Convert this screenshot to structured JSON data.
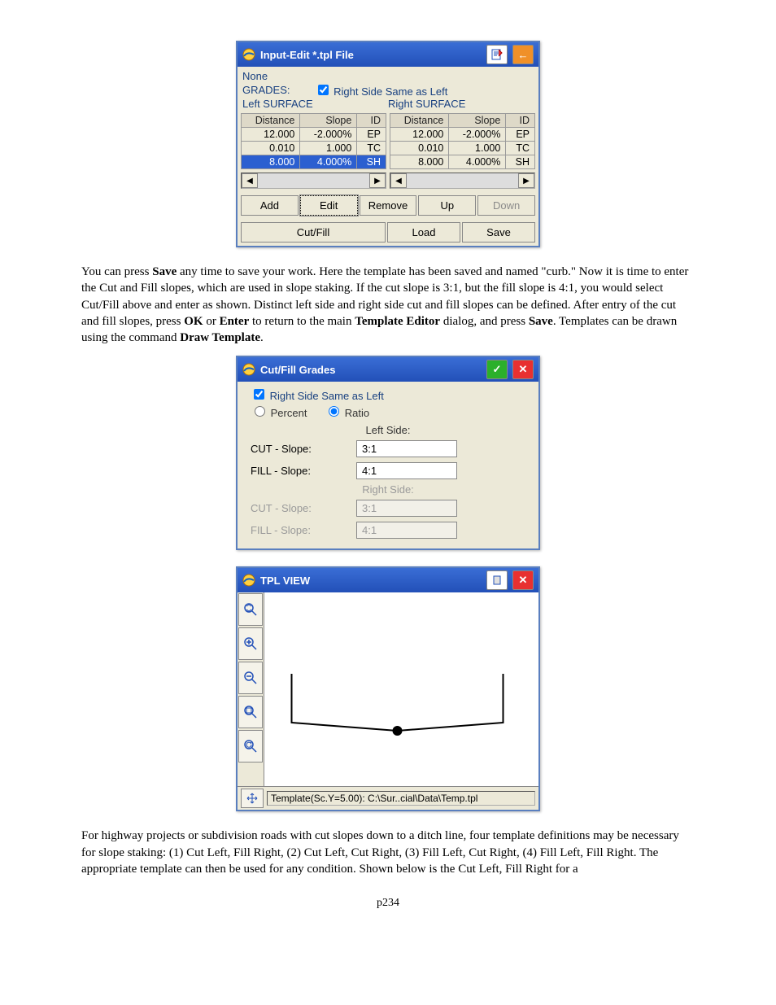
{
  "dialog1": {
    "title": "Input-Edit *.tpl File",
    "none": "None",
    "grades": "GRADES:",
    "chk_label": "Right Side Same as Left",
    "left_surface": "Left SURFACE",
    "right_surface": "Right SURFACE",
    "headers": {
      "distance": "Distance",
      "slope": "Slope",
      "id": "ID"
    },
    "left_rows": [
      {
        "distance": "12.000",
        "slope": "-2.000%",
        "id": "EP"
      },
      {
        "distance": "0.010",
        "slope": "1.000",
        "id": "TC"
      },
      {
        "distance": "8.000",
        "slope": "4.000%",
        "id": "SH",
        "selected": true
      }
    ],
    "right_rows": [
      {
        "distance": "12.000",
        "slope": "-2.000%",
        "id": "EP"
      },
      {
        "distance": "0.010",
        "slope": "1.000",
        "id": "TC"
      },
      {
        "distance": "8.000",
        "slope": "4.000%",
        "id": "SH"
      }
    ],
    "buttons": {
      "add": "Add",
      "edit": "Edit",
      "remove": "Remove",
      "up": "Up",
      "down": "Down",
      "cutfill": "Cut/Fill",
      "load": "Load",
      "save": "Save"
    }
  },
  "para1_a": "You can press ",
  "para1_b": "Save",
  "para1_c": " any time to save your work.  Here the template has been saved and named \"curb.\"  Now it is time to enter the Cut and Fill slopes, which are used in slope staking.  If the cut slope is 3:1, but the fill slope is 4:1, you would select Cut/Fill above and enter as shown.  Distinct left side and right side cut and fill slopes can be defined.  After entry of the cut and fill slopes, press ",
  "para1_d": "OK",
  "para1_e": " or ",
  "para1_f": "Enter",
  "para1_g": " to return to the main  ",
  "para1_h": "Template Editor",
  "para1_i": " dialog, and press ",
  "para1_j": "Save",
  "para1_k": ".  Templates can be drawn using the command ",
  "para1_l": "Draw Template",
  "para1_m": ".",
  "dialog2": {
    "title": "Cut/Fill Grades",
    "chk_label": "Right Side Same as Left",
    "percent": "Percent",
    "ratio": "Ratio",
    "left_side": "Left Side:",
    "right_side": "Right Side:",
    "cut_label": "CUT - Slope:",
    "fill_label": "FILL - Slope:",
    "left_cut": "3:1",
    "left_fill": "4:1",
    "right_cut": "3:1",
    "right_fill": "4:1"
  },
  "dialog3": {
    "title": "TPL VIEW",
    "status": "Template(Sc.Y=5.00): C:\\Sur..cial\\Data\\Temp.tpl"
  },
  "para2": "For highway projects or subdivision roads with cut slopes down to a ditch line, four template definitions may be necessary for slope staking:  (1) Cut Left, Fill Right, (2) Cut Left, Cut Right, (3) Fill Left, Cut Right, (4) Fill Left, Fill Right.  The appropriate template can then be used for any condition.  Shown below is the Cut Left, Fill Right for a",
  "page": "p234"
}
